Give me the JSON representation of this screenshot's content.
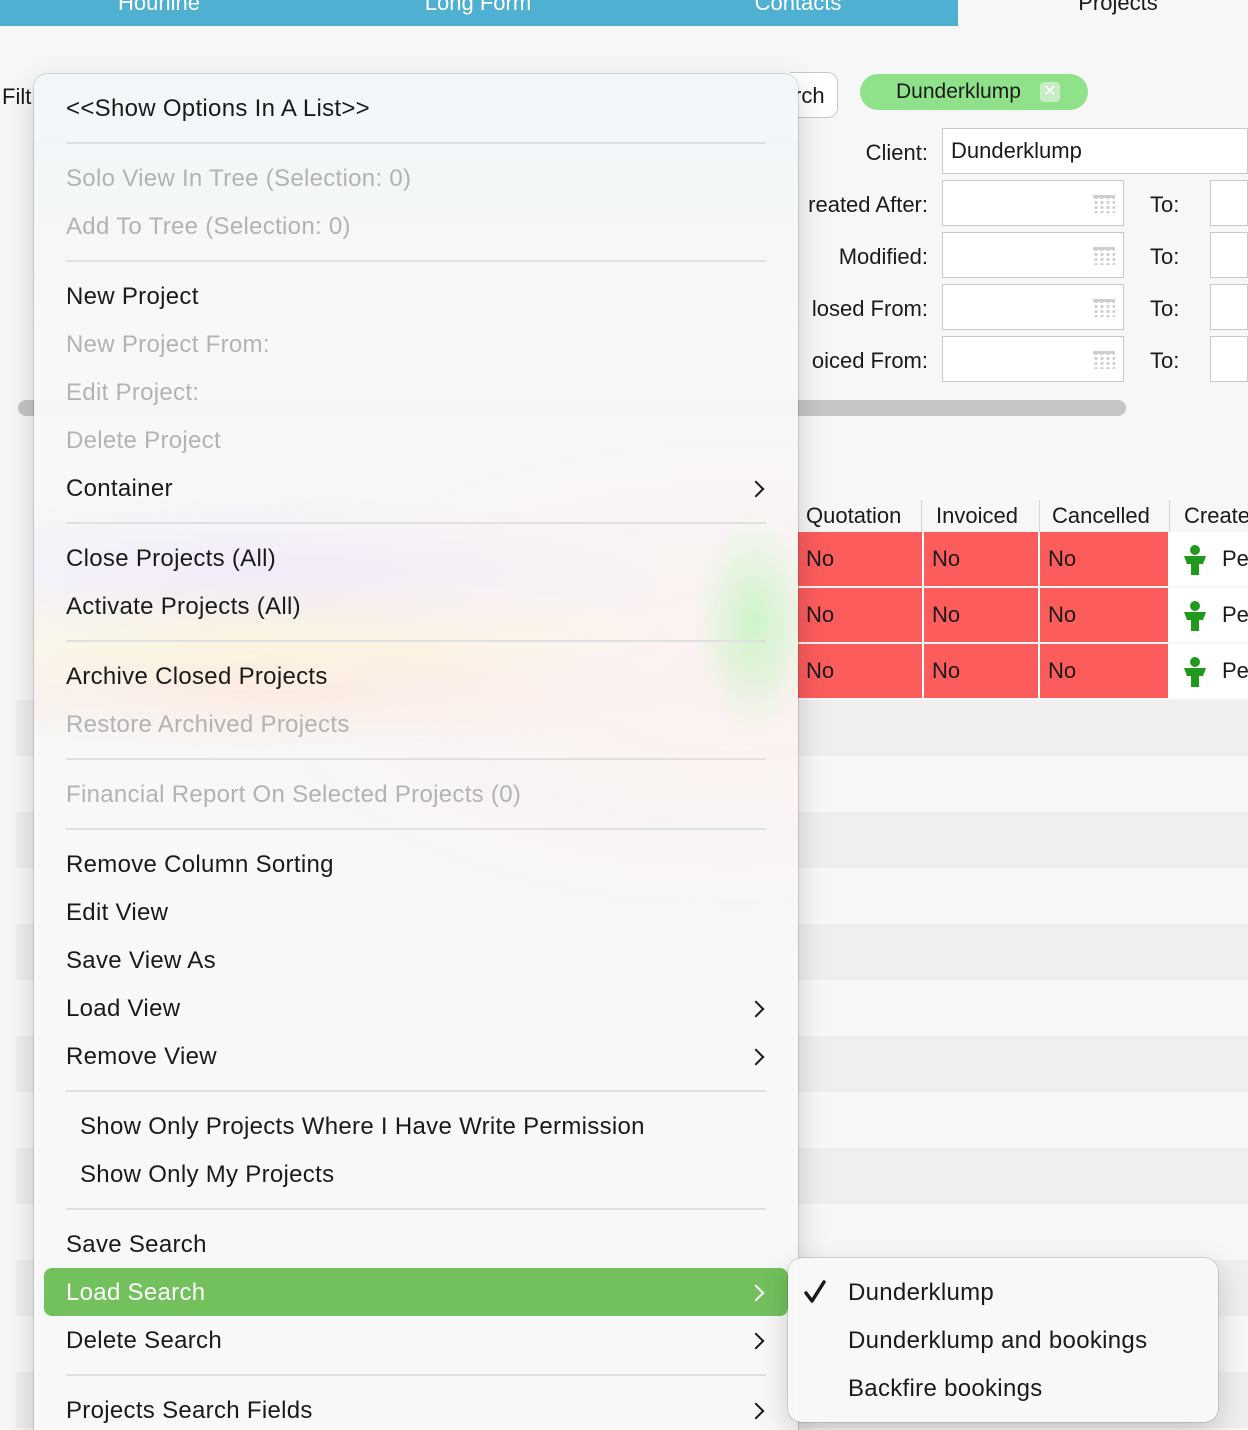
{
  "tabs": [
    {
      "label": "Hourline",
      "active": false
    },
    {
      "label": "Long Form",
      "active": false
    },
    {
      "label": "Contacts",
      "active": false
    },
    {
      "label": "Projects",
      "active": true
    }
  ],
  "filter": {
    "label_partial": "Filt",
    "search_button_partial": "rch",
    "chip_label": "Dunderklump"
  },
  "form": {
    "client_label": "Client:",
    "client_value": "Dunderklump",
    "created_after_label": "reated After:",
    "modified_label": "Modified:",
    "closed_from_label": "losed From:",
    "invoiced_from_label": "oiced From:",
    "to_label": "To:"
  },
  "table": {
    "columns": [
      "Quotation",
      "Invoiced",
      "Cancelled",
      "Create"
    ],
    "rows": [
      {
        "quotation": "No",
        "invoiced": "No",
        "cancelled": "No",
        "creator": "Pe"
      },
      {
        "quotation": "No",
        "invoiced": "No",
        "cancelled": "No",
        "creator": "Pe"
      },
      {
        "quotation": "No",
        "invoiced": "No",
        "cancelled": "No",
        "creator": "Pe"
      }
    ],
    "row_color": "#fc5c5c"
  },
  "menu": {
    "show_options": "<<Show Options In A List>>",
    "solo_view": "Solo View In Tree (Selection: 0)",
    "add_to_tree": "Add To Tree (Selection: 0)",
    "new_project": "New Project",
    "new_project_from": "New Project From:",
    "edit_project": "Edit Project:",
    "delete_project": "Delete Project",
    "container": "Container",
    "close_projects": "Close Projects (All)",
    "activate_projects": "Activate Projects (All)",
    "archive_closed": "Archive Closed Projects",
    "restore_archived": "Restore Archived Projects",
    "financial_report": "Financial Report On Selected Projects (0)",
    "remove_sorting": "Remove Column Sorting",
    "edit_view": "Edit View",
    "save_view_as": "Save View As",
    "load_view": "Load View",
    "remove_view": "Remove View",
    "show_write_permission": "Show Only Projects Where I Have Write Permission",
    "show_my_projects": "Show Only My Projects",
    "save_search": "Save Search",
    "load_search": "Load Search",
    "delete_search": "Delete Search",
    "search_fields": "Projects Search Fields",
    "highlight_color": "#72c15d"
  },
  "submenu": {
    "items": [
      {
        "label": "Dunderklump",
        "checked": true
      },
      {
        "label": "Dunderklump and bookings",
        "checked": false
      },
      {
        "label": "Backfire bookings",
        "checked": false
      }
    ]
  },
  "icons": [
    "calendar-icon",
    "person-icon",
    "chevron-right-icon",
    "checkmark-icon",
    "close-icon"
  ]
}
